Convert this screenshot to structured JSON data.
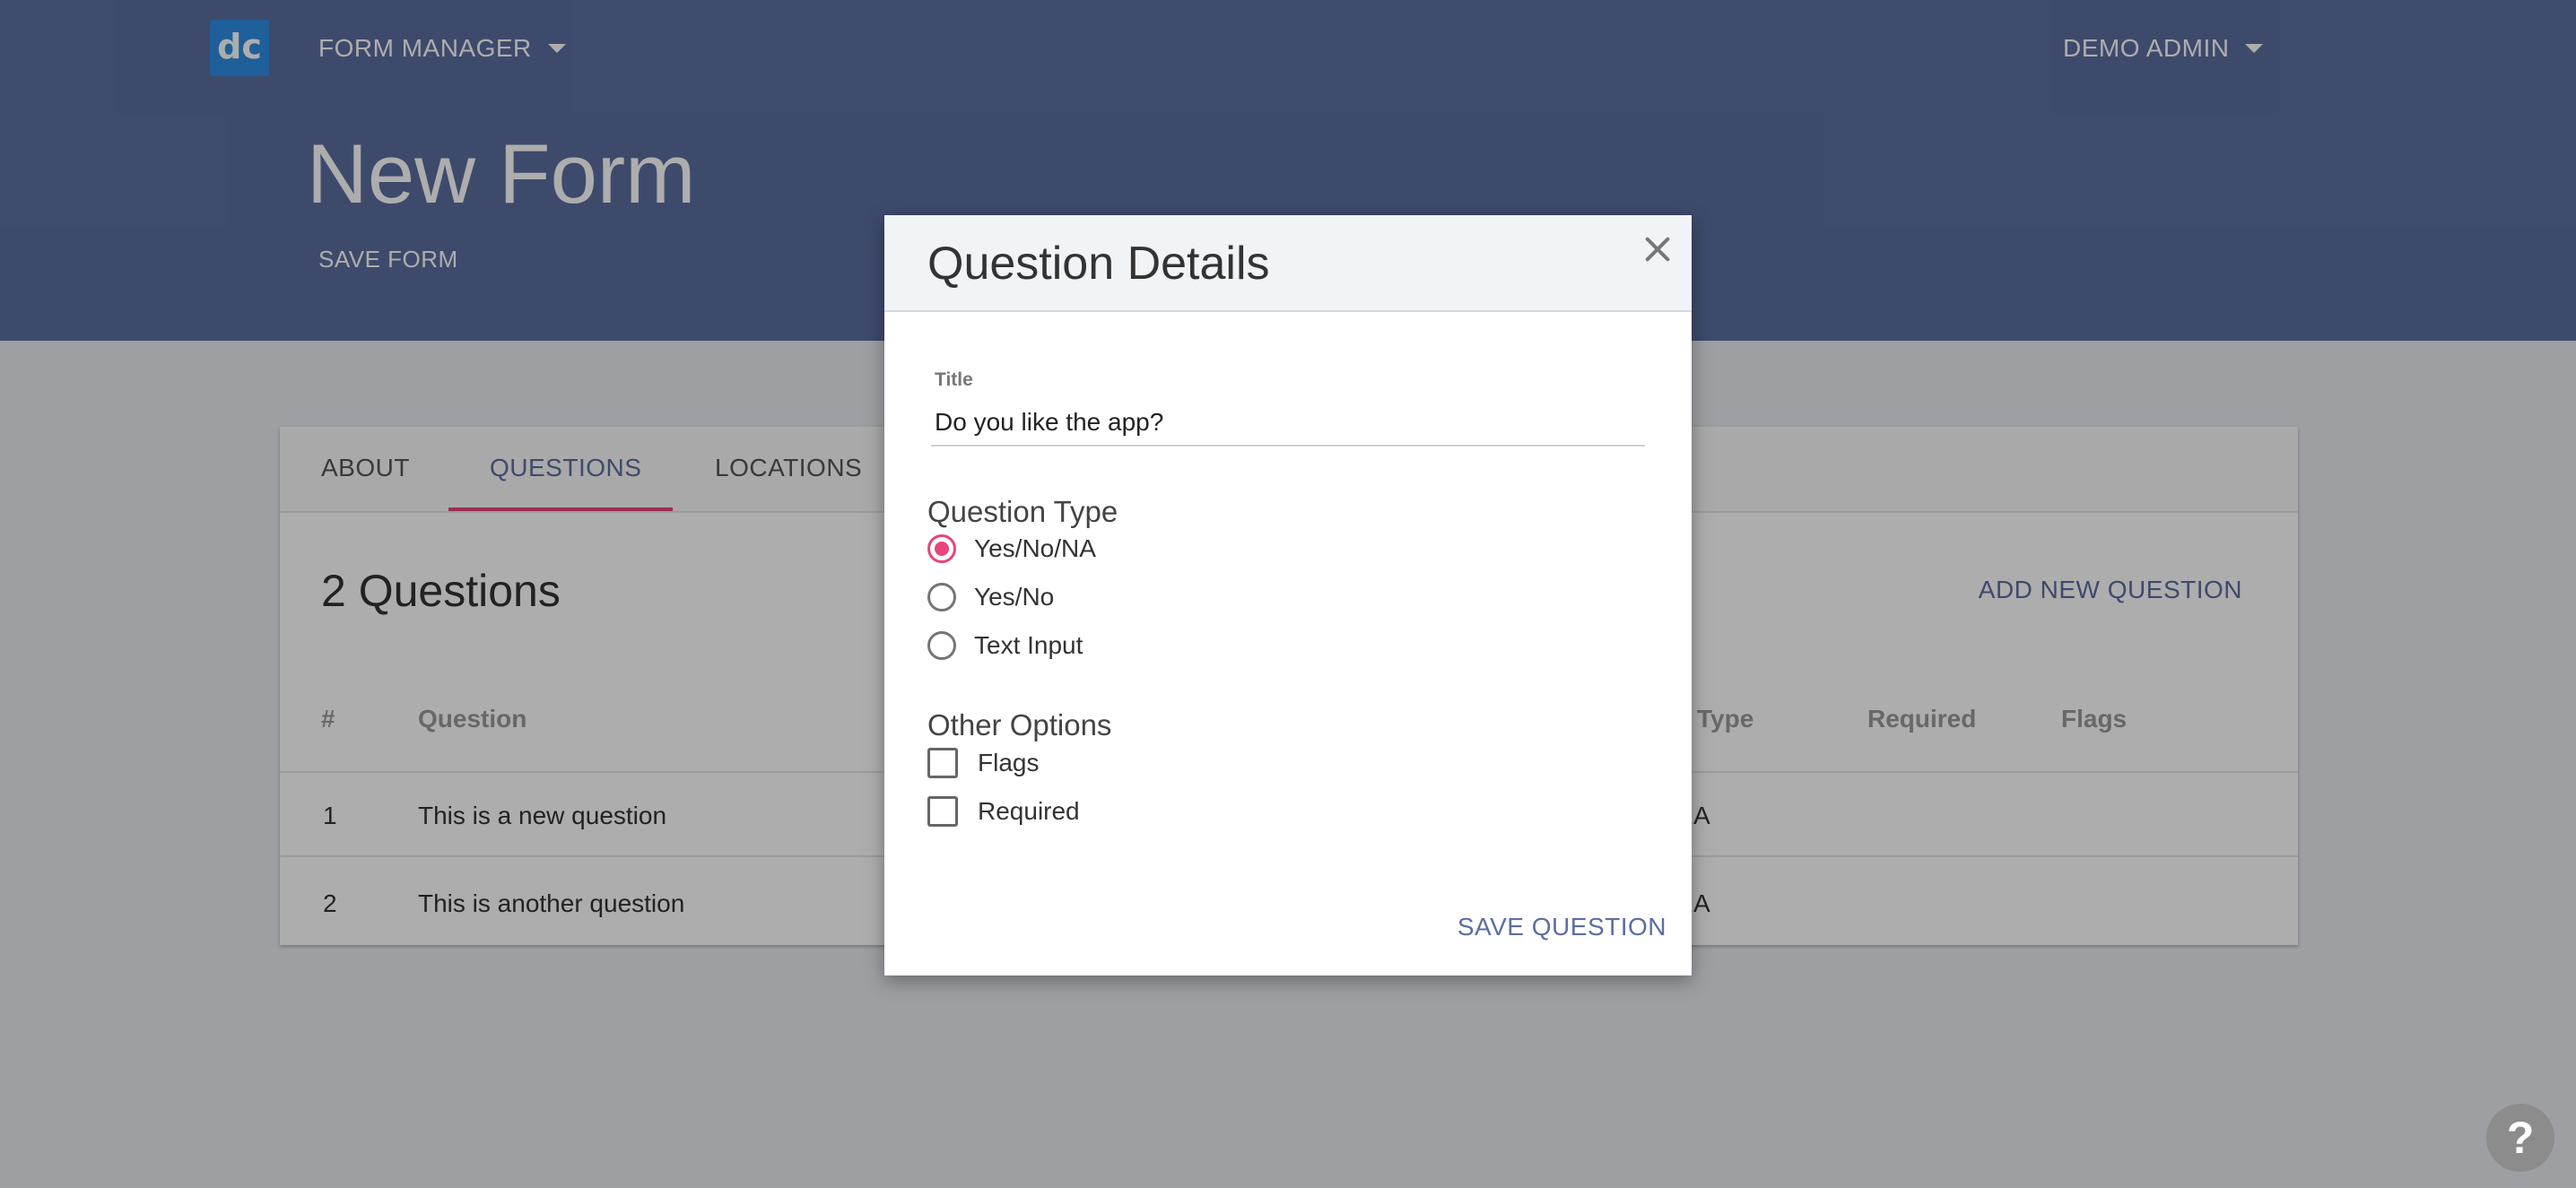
{
  "header": {
    "logo_text": "dc",
    "app_menu": "FORM MANAGER",
    "user_menu": "DEMO ADMIN",
    "page_title": "New Form",
    "save_form": "SAVE FORM"
  },
  "tabs": [
    {
      "label": "ABOUT"
    },
    {
      "label": "QUESTIONS"
    },
    {
      "label": "LOCATIONS"
    }
  ],
  "questions_panel": {
    "heading": "2 Questions",
    "add_button": "ADD NEW QUESTION",
    "columns": [
      "#",
      "Question",
      "Type",
      "Required",
      "Flags"
    ],
    "rows": [
      {
        "num": "1",
        "question": "This is a new question",
        "type": "A"
      },
      {
        "num": "2",
        "question": "This is another question",
        "type": "A"
      }
    ]
  },
  "dialog": {
    "title": "Question Details",
    "field_label": "Title",
    "field_value": "Do you like the app?",
    "question_type_label": "Question Type",
    "question_types": [
      {
        "label": "Yes/No/NA",
        "checked": true
      },
      {
        "label": "Yes/No",
        "checked": false
      },
      {
        "label": "Text Input",
        "checked": false
      }
    ],
    "other_options_label": "Other Options",
    "other_options": [
      {
        "label": "Flags",
        "checked": false
      },
      {
        "label": "Required",
        "checked": false
      }
    ],
    "save_button": "SAVE QUESTION"
  },
  "help": {
    "label": "?"
  },
  "colors": {
    "header": "#5c6ea0",
    "accent": "#e8457a",
    "logo": "#2f8de4"
  }
}
